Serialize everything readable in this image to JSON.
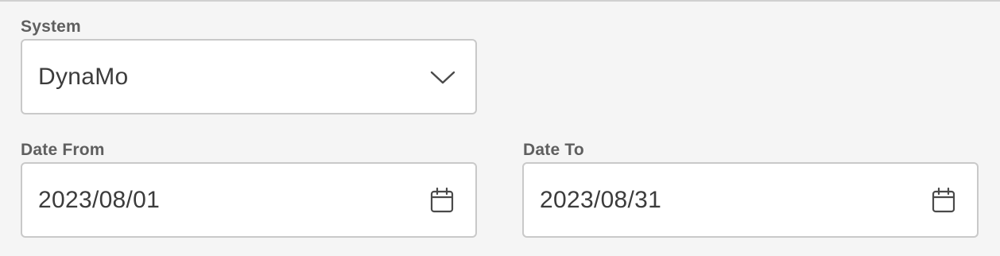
{
  "system": {
    "label": "System",
    "value": "DynaMo",
    "icon": "chevron-down-icon"
  },
  "date_from": {
    "label": "Date From",
    "value": "2023/08/01",
    "icon": "calendar-icon"
  },
  "date_to": {
    "label": "Date To",
    "value": "2023/08/31",
    "icon": "calendar-icon"
  },
  "colors": {
    "background": "#f5f5f5",
    "field_border": "#c9c9c9",
    "label_text": "#5f5f5f",
    "value_text": "#3c3c3c",
    "icon": "#4a4a4a"
  }
}
